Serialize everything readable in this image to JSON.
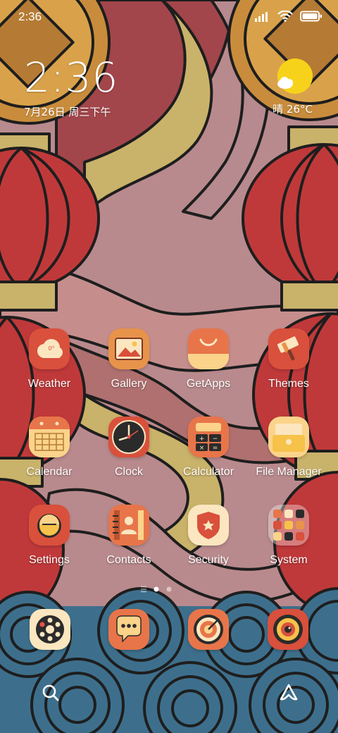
{
  "status_bar": {
    "time": "2:36",
    "icons": [
      "signal-icon",
      "wifi-icon",
      "battery-icon"
    ]
  },
  "clock_widget": {
    "time": "2:36",
    "date": "7月26日 周三下午"
  },
  "weather_widget": {
    "condition": "晴 26°C",
    "icon": "sun-cloud-icon"
  },
  "apps": [
    {
      "label": "Weather",
      "icon": "weather-icon"
    },
    {
      "label": "Gallery",
      "icon": "gallery-icon"
    },
    {
      "label": "GetApps",
      "icon": "getapps-icon"
    },
    {
      "label": "Themes",
      "icon": "themes-icon"
    },
    {
      "label": "Calendar",
      "icon": "calendar-icon"
    },
    {
      "label": "Clock",
      "icon": "clock-icon"
    },
    {
      "label": "Calculator",
      "icon": "calculator-icon"
    },
    {
      "label": "File Manager",
      "icon": "file-manager-icon"
    },
    {
      "label": "Settings",
      "icon": "settings-icon"
    },
    {
      "label": "Contacts",
      "icon": "contacts-icon"
    },
    {
      "label": "Security",
      "icon": "security-icon"
    },
    {
      "label": "System",
      "icon": "system-folder-icon"
    }
  ],
  "weather_icon_text": "0°",
  "dock": [
    "phone-icon",
    "messages-icon",
    "browser-icon",
    "camera-icon"
  ],
  "page_indicator": {
    "current": 2,
    "total": 3
  },
  "colors": {
    "red": "#d9503c",
    "orange": "#e8934a",
    "cream": "#fbe6c0",
    "yellow": "#f6c24a",
    "dark": "#2b2b2b",
    "wallpaper_bg": "#b98a8d",
    "wave_blue": "#3d6f8c"
  }
}
